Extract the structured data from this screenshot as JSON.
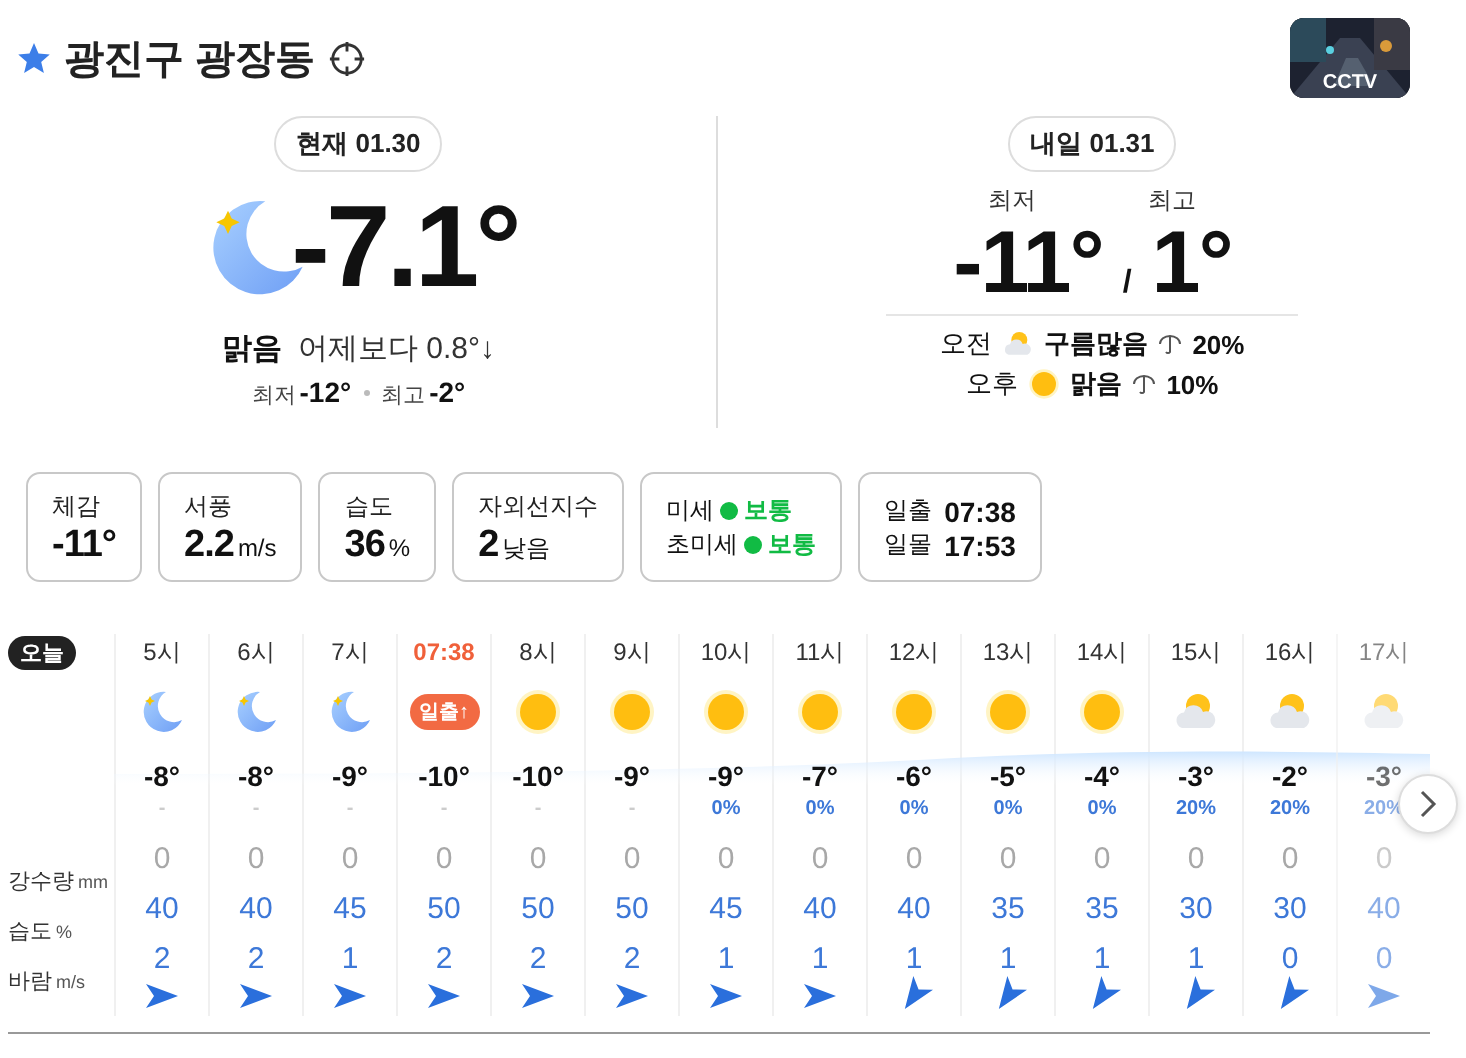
{
  "location": {
    "name": "광진구 광장동",
    "favorite": true
  },
  "cctv": {
    "label": "CCTV"
  },
  "today": {
    "badge": "현재 01.30",
    "kind": "moon",
    "temperature": "-7.1°",
    "condition": "맑음",
    "compare": "어제보다 0.8°↓",
    "low_label": "최저",
    "low": "-12°",
    "high_label": "최고",
    "high": "-2°"
  },
  "tomorrow": {
    "badge": "내일 01.31",
    "low_label": "최저",
    "high_label": "최고",
    "low": "-11°",
    "separator": "/",
    "high": "1°",
    "periods": [
      {
        "label": "오전",
        "kind": "partly",
        "condition": "구름많음",
        "rain": "20%"
      },
      {
        "label": "오후",
        "kind": "sun",
        "condition": "맑음",
        "rain": "10%"
      }
    ]
  },
  "details": [
    {
      "kind": "single",
      "label": "체감",
      "value": "-11°"
    },
    {
      "kind": "single",
      "label": "서풍",
      "value": "2.2",
      "unit": "m/s"
    },
    {
      "kind": "single",
      "label": "습도",
      "value": "36",
      "unit": "%"
    },
    {
      "kind": "single",
      "label": "자외선지수",
      "value": "2",
      "unit": "낮음"
    },
    {
      "kind": "dust",
      "lines": [
        {
          "label": "미세",
          "status": "보통",
          "color": "#11bb44"
        },
        {
          "label": "초미세",
          "status": "보통",
          "color": "#11bb44"
        }
      ]
    },
    {
      "kind": "sun",
      "lines": [
        {
          "label": "일출",
          "time": "07:38"
        },
        {
          "label": "일몰",
          "time": "17:53"
        }
      ]
    }
  ],
  "hourly": {
    "day_badge": "오늘",
    "row_labels": [
      {
        "label": "강수량",
        "unit": "mm"
      },
      {
        "label": "습도",
        "unit": "%"
      },
      {
        "label": "바람",
        "unit": "m/s"
      }
    ],
    "hours": [
      {
        "time": "5시",
        "kind": "moon",
        "temp": "-8°",
        "prob": "-",
        "rain": "0",
        "humidity": "40",
        "wind": {
          "speed": "2",
          "kind": "east"
        },
        "faded": false
      },
      {
        "time": "6시",
        "kind": "moon",
        "temp": "-8°",
        "prob": "-",
        "rain": "0",
        "humidity": "40",
        "wind": {
          "speed": "2",
          "kind": "east"
        },
        "faded": false
      },
      {
        "time": "7시",
        "kind": "moon",
        "temp": "-9°",
        "prob": "-",
        "rain": "0",
        "humidity": "45",
        "wind": {
          "speed": "1",
          "kind": "east"
        },
        "faded": false
      },
      {
        "time": "07:38",
        "kind": "sunrise",
        "badge": "일출↑",
        "temp": "-10°",
        "prob": "-",
        "rain": "0",
        "humidity": "50",
        "wind": {
          "speed": "2",
          "kind": "east"
        },
        "faded": false
      },
      {
        "time": "8시",
        "kind": "sun",
        "temp": "-10°",
        "prob": "-",
        "rain": "0",
        "humidity": "50",
        "wind": {
          "speed": "2",
          "kind": "east"
        },
        "faded": false
      },
      {
        "time": "9시",
        "kind": "sun",
        "temp": "-9°",
        "prob": "-",
        "rain": "0",
        "humidity": "50",
        "wind": {
          "speed": "2",
          "kind": "east"
        },
        "faded": false
      },
      {
        "time": "10시",
        "kind": "sun",
        "temp": "-9°",
        "prob": "0%",
        "rain": "0",
        "humidity": "45",
        "wind": {
          "speed": "1",
          "kind": "east"
        },
        "faded": false
      },
      {
        "time": "11시",
        "kind": "sun",
        "temp": "-7°",
        "prob": "0%",
        "rain": "0",
        "humidity": "40",
        "wind": {
          "speed": "1",
          "kind": "east"
        },
        "faded": false
      },
      {
        "time": "12시",
        "kind": "sun",
        "temp": "-6°",
        "prob": "0%",
        "rain": "0",
        "humidity": "40",
        "wind": {
          "speed": "1",
          "kind": "south"
        },
        "faded": false
      },
      {
        "time": "13시",
        "kind": "sun",
        "temp": "-5°",
        "prob": "0%",
        "rain": "0",
        "humidity": "35",
        "wind": {
          "speed": "1",
          "kind": "south"
        },
        "faded": false
      },
      {
        "time": "14시",
        "kind": "sun",
        "temp": "-4°",
        "prob": "0%",
        "rain": "0",
        "humidity": "35",
        "wind": {
          "speed": "1",
          "kind": "south"
        },
        "faded": false
      },
      {
        "time": "15시",
        "kind": "partly",
        "temp": "-3°",
        "prob": "20%",
        "rain": "0",
        "humidity": "30",
        "wind": {
          "speed": "1",
          "kind": "south"
        },
        "faded": false
      },
      {
        "time": "16시",
        "kind": "partly",
        "temp": "-2°",
        "prob": "20%",
        "rain": "0",
        "humidity": "30",
        "wind": {
          "speed": "0",
          "kind": "south"
        },
        "faded": false
      },
      {
        "time": "17시",
        "kind": "partly",
        "temp": "-3°",
        "prob": "20%",
        "rain": "0",
        "humidity": "40",
        "wind": {
          "speed": "0",
          "kind": "east"
        },
        "faded": true
      }
    ]
  }
}
